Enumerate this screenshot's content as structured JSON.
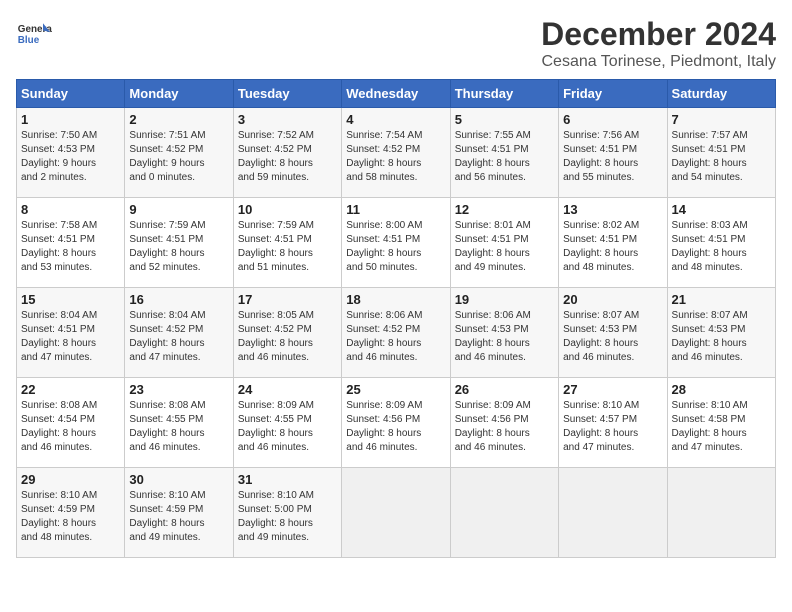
{
  "header": {
    "logo_line1": "General",
    "logo_line2": "Blue",
    "title": "December 2024",
    "subtitle": "Cesana Torinese, Piedmont, Italy"
  },
  "weekdays": [
    "Sunday",
    "Monday",
    "Tuesday",
    "Wednesday",
    "Thursday",
    "Friday",
    "Saturday"
  ],
  "weeks": [
    [
      {
        "day": "1",
        "info": "Sunrise: 7:50 AM\nSunset: 4:53 PM\nDaylight: 9 hours\nand 2 minutes."
      },
      {
        "day": "2",
        "info": "Sunrise: 7:51 AM\nSunset: 4:52 PM\nDaylight: 9 hours\nand 0 minutes."
      },
      {
        "day": "3",
        "info": "Sunrise: 7:52 AM\nSunset: 4:52 PM\nDaylight: 8 hours\nand 59 minutes."
      },
      {
        "day": "4",
        "info": "Sunrise: 7:54 AM\nSunset: 4:52 PM\nDaylight: 8 hours\nand 58 minutes."
      },
      {
        "day": "5",
        "info": "Sunrise: 7:55 AM\nSunset: 4:51 PM\nDaylight: 8 hours\nand 56 minutes."
      },
      {
        "day": "6",
        "info": "Sunrise: 7:56 AM\nSunset: 4:51 PM\nDaylight: 8 hours\nand 55 minutes."
      },
      {
        "day": "7",
        "info": "Sunrise: 7:57 AM\nSunset: 4:51 PM\nDaylight: 8 hours\nand 54 minutes."
      }
    ],
    [
      {
        "day": "8",
        "info": "Sunrise: 7:58 AM\nSunset: 4:51 PM\nDaylight: 8 hours\nand 53 minutes."
      },
      {
        "day": "9",
        "info": "Sunrise: 7:59 AM\nSunset: 4:51 PM\nDaylight: 8 hours\nand 52 minutes."
      },
      {
        "day": "10",
        "info": "Sunrise: 7:59 AM\nSunset: 4:51 PM\nDaylight: 8 hours\nand 51 minutes."
      },
      {
        "day": "11",
        "info": "Sunrise: 8:00 AM\nSunset: 4:51 PM\nDaylight: 8 hours\nand 50 minutes."
      },
      {
        "day": "12",
        "info": "Sunrise: 8:01 AM\nSunset: 4:51 PM\nDaylight: 8 hours\nand 49 minutes."
      },
      {
        "day": "13",
        "info": "Sunrise: 8:02 AM\nSunset: 4:51 PM\nDaylight: 8 hours\nand 48 minutes."
      },
      {
        "day": "14",
        "info": "Sunrise: 8:03 AM\nSunset: 4:51 PM\nDaylight: 8 hours\nand 48 minutes."
      }
    ],
    [
      {
        "day": "15",
        "info": "Sunrise: 8:04 AM\nSunset: 4:51 PM\nDaylight: 8 hours\nand 47 minutes."
      },
      {
        "day": "16",
        "info": "Sunrise: 8:04 AM\nSunset: 4:52 PM\nDaylight: 8 hours\nand 47 minutes."
      },
      {
        "day": "17",
        "info": "Sunrise: 8:05 AM\nSunset: 4:52 PM\nDaylight: 8 hours\nand 46 minutes."
      },
      {
        "day": "18",
        "info": "Sunrise: 8:06 AM\nSunset: 4:52 PM\nDaylight: 8 hours\nand 46 minutes."
      },
      {
        "day": "19",
        "info": "Sunrise: 8:06 AM\nSunset: 4:53 PM\nDaylight: 8 hours\nand 46 minutes."
      },
      {
        "day": "20",
        "info": "Sunrise: 8:07 AM\nSunset: 4:53 PM\nDaylight: 8 hours\nand 46 minutes."
      },
      {
        "day": "21",
        "info": "Sunrise: 8:07 AM\nSunset: 4:53 PM\nDaylight: 8 hours\nand 46 minutes."
      }
    ],
    [
      {
        "day": "22",
        "info": "Sunrise: 8:08 AM\nSunset: 4:54 PM\nDaylight: 8 hours\nand 46 minutes."
      },
      {
        "day": "23",
        "info": "Sunrise: 8:08 AM\nSunset: 4:55 PM\nDaylight: 8 hours\nand 46 minutes."
      },
      {
        "day": "24",
        "info": "Sunrise: 8:09 AM\nSunset: 4:55 PM\nDaylight: 8 hours\nand 46 minutes."
      },
      {
        "day": "25",
        "info": "Sunrise: 8:09 AM\nSunset: 4:56 PM\nDaylight: 8 hours\nand 46 minutes."
      },
      {
        "day": "26",
        "info": "Sunrise: 8:09 AM\nSunset: 4:56 PM\nDaylight: 8 hours\nand 46 minutes."
      },
      {
        "day": "27",
        "info": "Sunrise: 8:10 AM\nSunset: 4:57 PM\nDaylight: 8 hours\nand 47 minutes."
      },
      {
        "day": "28",
        "info": "Sunrise: 8:10 AM\nSunset: 4:58 PM\nDaylight: 8 hours\nand 47 minutes."
      }
    ],
    [
      {
        "day": "29",
        "info": "Sunrise: 8:10 AM\nSunset: 4:59 PM\nDaylight: 8 hours\nand 48 minutes."
      },
      {
        "day": "30",
        "info": "Sunrise: 8:10 AM\nSunset: 4:59 PM\nDaylight: 8 hours\nand 49 minutes."
      },
      {
        "day": "31",
        "info": "Sunrise: 8:10 AM\nSunset: 5:00 PM\nDaylight: 8 hours\nand 49 minutes."
      },
      null,
      null,
      null,
      null
    ]
  ]
}
